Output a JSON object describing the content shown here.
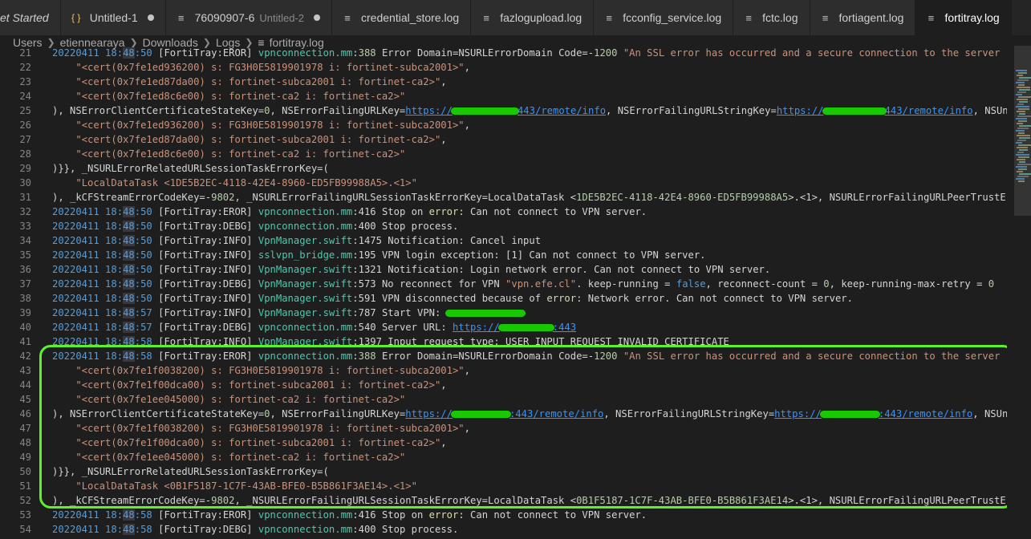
{
  "tabs": [
    {
      "label": "et Started",
      "sub": "",
      "dirty": false,
      "icon": "none",
      "italic": true
    },
    {
      "label": "Untitled-1",
      "sub": "",
      "dirty": true,
      "icon": "json-braces-icon"
    },
    {
      "label": "76090907-6",
      "sub": "Untitled-2",
      "dirty": true,
      "icon": "text-file-icon"
    },
    {
      "label": "credential_store.log",
      "sub": "",
      "dirty": false,
      "icon": "text-file-icon"
    },
    {
      "label": "fazlogupload.log",
      "sub": "",
      "dirty": false,
      "icon": "text-file-icon"
    },
    {
      "label": "fcconfig_service.log",
      "sub": "",
      "dirty": false,
      "icon": "text-file-icon"
    },
    {
      "label": "fctc.log",
      "sub": "",
      "dirty": false,
      "icon": "text-file-icon"
    },
    {
      "label": "fortiagent.log",
      "sub": "",
      "dirty": false,
      "icon": "text-file-icon"
    },
    {
      "label": "fortitray.log",
      "sub": "",
      "dirty": false,
      "icon": "text-file-icon",
      "active": true
    }
  ],
  "breadcrumb": {
    "items": [
      "Users",
      "etiennearaya",
      "Downloads",
      "Logs"
    ],
    "file": "fortitray.log"
  },
  "lines": [
    {
      "n": "21",
      "tokens": [
        [
          "ts",
          "20220411 18:"
        ],
        [
          "tsm",
          "48"
        ],
        [
          "ts",
          ":50 "
        ],
        [
          "pl",
          "[FortiTray:EROR] "
        ],
        [
          "mod",
          "vpnconnection.mm"
        ],
        [
          "pl",
          ":"
        ],
        [
          "num",
          "388"
        ],
        [
          "pl",
          " Error Domain=NSURLErrorDomain Code=-"
        ],
        [
          "num",
          "1200"
        ],
        [
          "str",
          " \"An SSL error has occurred and a secure connection to the server can"
        ]
      ]
    },
    {
      "n": "22",
      "tokens": [
        [
          "pl",
          "    "
        ],
        [
          "str",
          "\"<cert(0x7fe1ed936200) s: FG3H0E5819901978 i: fortinet-subca2001>\""
        ],
        [
          "pl",
          ","
        ]
      ]
    },
    {
      "n": "23",
      "tokens": [
        [
          "pl",
          "    "
        ],
        [
          "str",
          "\"<cert(0x7fe1ed87da00) s: fortinet-subca2001 i: fortinet-ca2>\""
        ],
        [
          "pl",
          ","
        ]
      ]
    },
    {
      "n": "24",
      "tokens": [
        [
          "pl",
          "    "
        ],
        [
          "str",
          "\"<cert(0x7fe1ed8c6e00) s: fortinet-ca2 i: fortinet-ca2>\""
        ]
      ]
    },
    {
      "n": "25",
      "tokens": [
        [
          "pl",
          "), NSErrorClientCertificateStateKey="
        ],
        [
          "num",
          "0"
        ],
        [
          "pl",
          ", NSErrorFailingURLKey="
        ],
        [
          "link",
          "https://"
        ],
        [
          "red",
          "85"
        ],
        [
          "link",
          "443/remote/info"
        ],
        [
          "pl",
          ", NSErrorFailingURLStringKey="
        ],
        [
          "link",
          "https://"
        ],
        [
          "red",
          "80"
        ],
        [
          "link",
          "443/remote/info"
        ],
        [
          "pl",
          ", NSUnde"
        ]
      ]
    },
    {
      "n": "26",
      "tokens": [
        [
          "pl",
          "    "
        ],
        [
          "str",
          "\"<cert(0x7fe1ed936200) s: FG3H0E5819901978 i: fortinet-subca2001>\""
        ],
        [
          "pl",
          ","
        ]
      ]
    },
    {
      "n": "27",
      "tokens": [
        [
          "pl",
          "    "
        ],
        [
          "str",
          "\"<cert(0x7fe1ed87da00) s: fortinet-subca2001 i: fortinet-ca2>\""
        ],
        [
          "pl",
          ","
        ]
      ]
    },
    {
      "n": "28",
      "tokens": [
        [
          "pl",
          "    "
        ],
        [
          "str",
          "\"<cert(0x7fe1ed8c6e00) s: fortinet-ca2 i: fortinet-ca2>\""
        ]
      ]
    },
    {
      "n": "29",
      "tokens": [
        [
          "pl",
          ")}}, _NSURLErrorRelatedURLSessionTaskErrorKey=("
        ]
      ]
    },
    {
      "n": "30",
      "tokens": [
        [
          "pl",
          "    "
        ],
        [
          "str",
          "\"LocalDataTask <1DE5B2EC-4118-42E4-8960-ED5FB99988A5>.<1>\""
        ]
      ]
    },
    {
      "n": "31",
      "tokens": [
        [
          "pl",
          "), _kCFStreamErrorCodeKey=-"
        ],
        [
          "num",
          "9802"
        ],
        [
          "pl",
          ", _NSURLErrorFailingURLSessionTaskErrorKey=LocalDataTask <"
        ],
        [
          "num",
          "1DE5B2EC-4118-42E4-8960-ED5FB99988A5"
        ],
        [
          "pl",
          ">.<1>, NSURLErrorFailingURLPeerTrustErro"
        ]
      ]
    },
    {
      "n": "32",
      "tokens": [
        [
          "ts",
          "20220411 18:"
        ],
        [
          "tsm",
          "48"
        ],
        [
          "ts",
          ":50 "
        ],
        [
          "pl",
          "[FortiTray:EROR] "
        ],
        [
          "mod",
          "vpnconnection.mm"
        ],
        [
          "pl",
          ":416 Stop on "
        ],
        [
          "warn",
          "error:"
        ],
        [
          "pl",
          " Can not connect to VPN server."
        ]
      ]
    },
    {
      "n": "33",
      "tokens": [
        [
          "ts",
          "20220411 18:"
        ],
        [
          "tsm",
          "48"
        ],
        [
          "ts",
          ":50 "
        ],
        [
          "pl",
          "[FortiTray:DEBG] "
        ],
        [
          "mod",
          "vpnconnection.mm"
        ],
        [
          "pl",
          ":400 Stop process."
        ]
      ]
    },
    {
      "n": "34",
      "tokens": [
        [
          "ts",
          "20220411 18:"
        ],
        [
          "tsm",
          "48"
        ],
        [
          "ts",
          ":50 "
        ],
        [
          "pl",
          "[FortiTray:INFO] "
        ],
        [
          "mod",
          "VpnManager.swift"
        ],
        [
          "pl",
          ":1475 Notification: Cancel input"
        ]
      ]
    },
    {
      "n": "35",
      "tokens": [
        [
          "ts",
          "20220411 18:"
        ],
        [
          "tsm",
          "48"
        ],
        [
          "ts",
          ":50 "
        ],
        [
          "pl",
          "[FortiTray:INFO] "
        ],
        [
          "mod",
          "sslvpn_bridge.mm"
        ],
        [
          "pl",
          ":195 VPN login exception: [1] Can not connect to VPN server."
        ]
      ]
    },
    {
      "n": "36",
      "tokens": [
        [
          "ts",
          "20220411 18:"
        ],
        [
          "tsm",
          "48"
        ],
        [
          "ts",
          ":50 "
        ],
        [
          "pl",
          "[FortiTray:INFO] "
        ],
        [
          "mod",
          "VpnManager.swift"
        ],
        [
          "pl",
          ":1321 Notification: Login network error. Can not connect to VPN server."
        ]
      ]
    },
    {
      "n": "37",
      "tokens": [
        [
          "ts",
          "20220411 18:"
        ],
        [
          "tsm",
          "48"
        ],
        [
          "ts",
          ":50 "
        ],
        [
          "pl",
          "[FortiTray:DEBG] "
        ],
        [
          "mod",
          "VpnManager.swift"
        ],
        [
          "pl",
          ":573 No reconnect for VPN "
        ],
        [
          "str",
          "\"vpn.efe.cl\""
        ],
        [
          "pl",
          ". keep-running = "
        ],
        [
          "kw",
          "false"
        ],
        [
          "pl",
          ", reconnect-count = "
        ],
        [
          "num",
          "0"
        ],
        [
          "pl",
          ", keep-running-max-retry = "
        ],
        [
          "num",
          "0"
        ]
      ]
    },
    {
      "n": "38",
      "tokens": [
        [
          "ts",
          "20220411 18:"
        ],
        [
          "tsm",
          "48"
        ],
        [
          "ts",
          ":50 "
        ],
        [
          "pl",
          "[FortiTray:INFO] "
        ],
        [
          "mod",
          "VpnManager.swift"
        ],
        [
          "pl",
          ":591 VPN disconnected because of "
        ],
        [
          "warn",
          "error:"
        ],
        [
          "pl",
          " Network error. Can not connect to VPN server."
        ]
      ]
    },
    {
      "n": "39",
      "tokens": [
        [
          "ts",
          "20220411 18:"
        ],
        [
          "tsm",
          "48"
        ],
        [
          "ts",
          ":57 "
        ],
        [
          "pl",
          "[FortiTray:INFO] "
        ],
        [
          "mod",
          "VpnManager.swift"
        ],
        [
          "pl",
          ":787 Start VPN: "
        ],
        [
          "red",
          "100"
        ]
      ]
    },
    {
      "n": "40",
      "tokens": [
        [
          "ts",
          "20220411 18:"
        ],
        [
          "tsm",
          "48"
        ],
        [
          "ts",
          ":57 "
        ],
        [
          "pl",
          "[FortiTray:DEBG] "
        ],
        [
          "mod",
          "vpnconnection.mm"
        ],
        [
          "pl",
          ":540 Server URL: "
        ],
        [
          "link",
          "https://"
        ],
        [
          "red",
          "70"
        ],
        [
          "link",
          ":443"
        ]
      ]
    },
    {
      "n": "41",
      "tokens": [
        [
          "ts",
          "20220411 18:"
        ],
        [
          "tsm",
          "48"
        ],
        [
          "ts",
          ":58 "
        ],
        [
          "pl",
          "[FortiTray:INFO] "
        ],
        [
          "mod",
          "VpnManager.swift"
        ],
        [
          "pl",
          ":1397 Input request type: USER_INPUT_REQUEST_INVALID_CERTIFICATE"
        ]
      ]
    },
    {
      "n": "42",
      "tokens": [
        [
          "ts",
          "20220411 18:"
        ],
        [
          "tsm",
          "48"
        ],
        [
          "ts",
          ":58 "
        ],
        [
          "pl",
          "[FortiTray:EROR] "
        ],
        [
          "mod",
          "vpnconnection.mm"
        ],
        [
          "pl",
          ":"
        ],
        [
          "num",
          "388"
        ],
        [
          "pl",
          " Error Domain=NSURLErrorDomain Code=-"
        ],
        [
          "num",
          "1200"
        ],
        [
          "str",
          " \"An SSL error has occurred and a secure connection to the server can"
        ]
      ]
    },
    {
      "n": "43",
      "tokens": [
        [
          "pl",
          "    "
        ],
        [
          "str",
          "\"<cert(0x7fe1f0038200) s: FG3H0E5819901978 i: fortinet-subca2001>\""
        ],
        [
          "pl",
          ","
        ]
      ]
    },
    {
      "n": "44",
      "tokens": [
        [
          "pl",
          "    "
        ],
        [
          "str",
          "\"<cert(0x7fe1f00dca00) s: fortinet-subca2001 i: fortinet-ca2>\""
        ],
        [
          "pl",
          ","
        ]
      ]
    },
    {
      "n": "45",
      "tokens": [
        [
          "pl",
          "    "
        ],
        [
          "str",
          "\"<cert(0x7fe1ee045000) s: fortinet-ca2 i: fortinet-ca2>\""
        ]
      ]
    },
    {
      "n": "46",
      "tokens": [
        [
          "pl",
          "), NSErrorClientCertificateStateKey="
        ],
        [
          "num",
          "0"
        ],
        [
          "pl",
          ", NSErrorFailingURLKey="
        ],
        [
          "link",
          "https://"
        ],
        [
          "red",
          "75"
        ],
        [
          "link",
          ":443/remote/info"
        ],
        [
          "pl",
          ", NSErrorFailingURLStringKey="
        ],
        [
          "link",
          "https://"
        ],
        [
          "red",
          "75"
        ],
        [
          "link",
          ":443/remote/info"
        ],
        [
          "pl",
          ", NSUnde"
        ]
      ]
    },
    {
      "n": "47",
      "tokens": [
        [
          "pl",
          "    "
        ],
        [
          "str",
          "\"<cert(0x7fe1f0038200) s: FG3H0E5819901978 i: fortinet-subca2001>\""
        ],
        [
          "pl",
          ","
        ]
      ]
    },
    {
      "n": "48",
      "tokens": [
        [
          "pl",
          "    "
        ],
        [
          "str",
          "\"<cert(0x7fe1f00dca00) s: fortinet-subca2001 i: fortinet-ca2>\""
        ],
        [
          "pl",
          ","
        ]
      ]
    },
    {
      "n": "49",
      "tokens": [
        [
          "pl",
          "    "
        ],
        [
          "str",
          "\"<cert(0x7fe1ee045000) s: fortinet-ca2 i: fortinet-ca2>\""
        ]
      ]
    },
    {
      "n": "50",
      "tokens": [
        [
          "pl",
          ")}}, _NSURLErrorRelatedURLSessionTaskErrorKey=("
        ]
      ]
    },
    {
      "n": "51",
      "tokens": [
        [
          "pl",
          "    "
        ],
        [
          "str",
          "\"LocalDataTask <0B1F5187-1C7F-43AB-BFE0-B5B861F3AE14>.<1>\""
        ]
      ]
    },
    {
      "n": "52",
      "tokens": [
        [
          "pl",
          "), _kCFStreamErrorCodeKey=-"
        ],
        [
          "num",
          "9802"
        ],
        [
          "pl",
          ", _NSURLErrorFailingURLSessionTaskErrorKey=LocalDataTask <"
        ],
        [
          "num",
          "0B1F5187-1C7F-43AB-BFE0-B5B861F3AE14"
        ],
        [
          "pl",
          ">.<1>, NSURLErrorFailingURLPeerTrustErro"
        ]
      ]
    },
    {
      "n": "53",
      "tokens": [
        [
          "ts",
          "20220411 18:"
        ],
        [
          "tsm",
          "48"
        ],
        [
          "ts",
          ":58 "
        ],
        [
          "pl",
          "[FortiTray:EROR] "
        ],
        [
          "mod",
          "vpnconnection.mm"
        ],
        [
          "pl",
          ":416 Stop on "
        ],
        [
          "warn",
          "error:"
        ],
        [
          "pl",
          " Can not connect to VPN server."
        ]
      ]
    },
    {
      "n": "54",
      "tokens": [
        [
          "ts",
          "20220411 18:"
        ],
        [
          "tsm",
          "48"
        ],
        [
          "ts",
          ":58 "
        ],
        [
          "pl",
          "[FortiTray:DEBG] "
        ],
        [
          "mod",
          "vpnconnection.mm"
        ],
        [
          "pl",
          ":400 Stop process."
        ]
      ]
    }
  ],
  "highlight": {
    "color": "#5ef02a"
  },
  "colors": {
    "background": "#1e1e1e",
    "timestamp": "#569cd6",
    "module": "#4ec9b0",
    "string": "#ce9178",
    "number": "#b5cea8",
    "link": "#3794ff",
    "redaction": "#18c800"
  }
}
